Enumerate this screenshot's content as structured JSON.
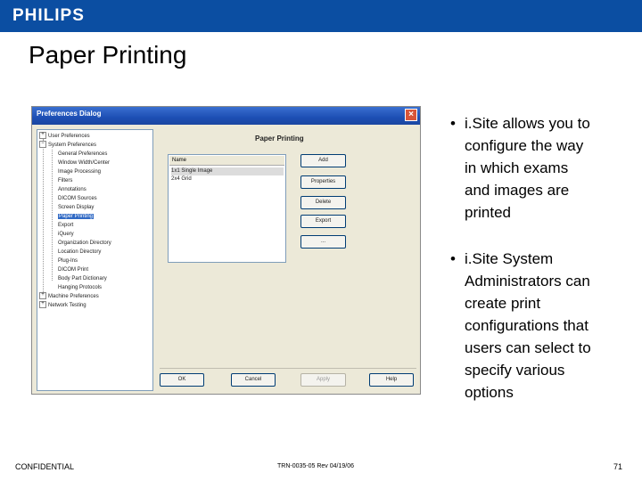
{
  "header": {
    "logo_text": "PHILIPS",
    "brand_color": "#0b4ea2"
  },
  "slide": {
    "title": "Paper Printing"
  },
  "dialog": {
    "title": "Preferences Dialog",
    "close_glyph": "×",
    "tree": [
      {
        "label": "User Preferences",
        "expander": "+"
      },
      {
        "label": "System Preferences",
        "expander": "−"
      },
      {
        "label": "General Preferences"
      },
      {
        "label": "Window Width/Center"
      },
      {
        "label": "Image Processing"
      },
      {
        "label": "Filters"
      },
      {
        "label": "Annotations"
      },
      {
        "label": "DICOM Sources"
      },
      {
        "label": "Screen Display"
      },
      {
        "label": "Paper Printing",
        "selected": true
      },
      {
        "label": "Export"
      },
      {
        "label": "iQuery"
      },
      {
        "label": "Organization Directory"
      },
      {
        "label": "Location Directory"
      },
      {
        "label": "Plug-Ins"
      },
      {
        "label": "DICOM Print"
      },
      {
        "label": "Body Part Dictionary"
      },
      {
        "label": "Hanging Protocols"
      },
      {
        "label": "Machine Preferences",
        "expander": "+"
      },
      {
        "label": "Network Testing",
        "expander": "+"
      }
    ],
    "panel_title": "Paper Printing",
    "list_header": "Name",
    "list_rows": [
      "1x1 Single Image",
      "2x4 Grid"
    ],
    "side_buttons": [
      "Add",
      "Properties",
      "Delete",
      "Export",
      "..."
    ],
    "bottom_buttons": [
      "OK",
      "Cancel",
      "Apply",
      "Help"
    ]
  },
  "bullets": [
    {
      "dot": "•",
      "text": "i.Site allows you to\nconfigure the way\nin which exams\nand images are\nprinted"
    },
    {
      "dot": "•",
      "text": "i.Site System\nAdministrators can\ncreate print\nconfigurations that\nusers can select to\nspecify various\noptions"
    }
  ],
  "footer": {
    "left": "CONFIDENTIAL",
    "center": "TRN-0035-05 Rev 04/19/06",
    "page": "71"
  }
}
